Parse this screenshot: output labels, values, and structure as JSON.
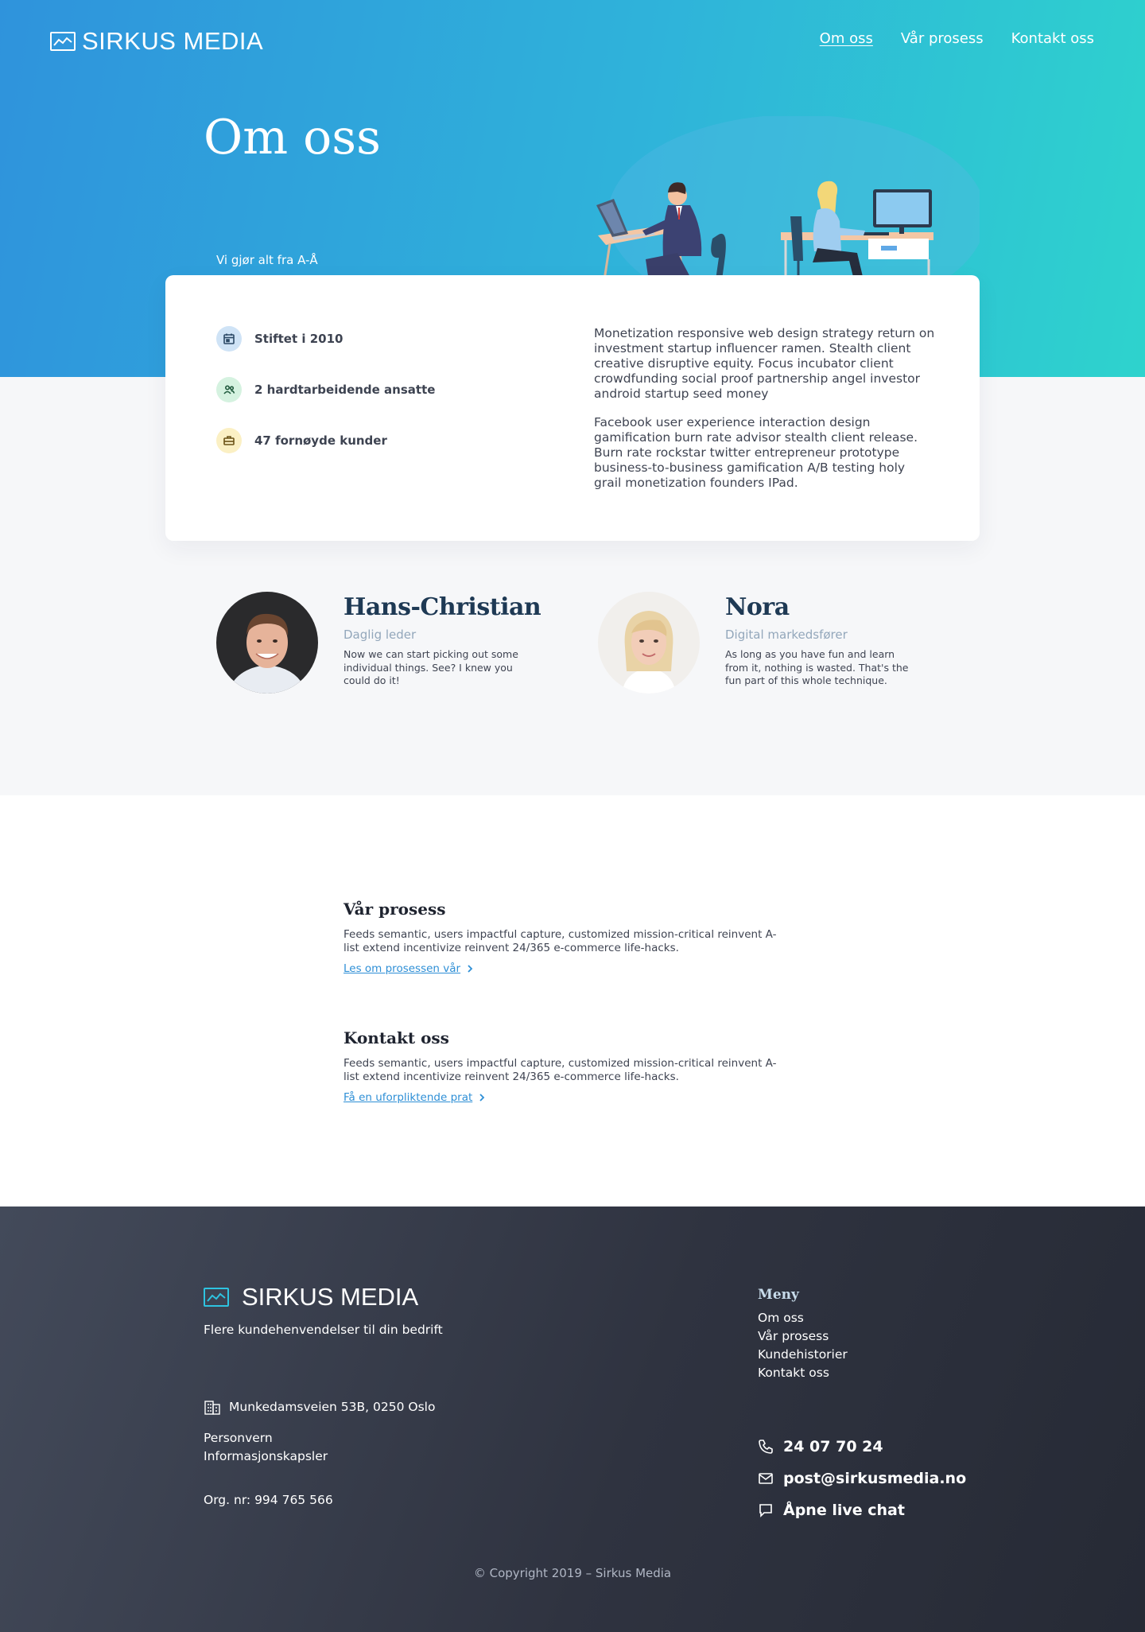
{
  "brand": {
    "name": "SIRKUS MEDIA"
  },
  "nav": [
    {
      "label": "Om oss",
      "active": true
    },
    {
      "label": "Vår prosess",
      "active": false
    },
    {
      "label": "Kontakt oss",
      "active": false
    }
  ],
  "hero": {
    "title": "Om oss",
    "tagline": "Vi gjør alt fra A-Å"
  },
  "facts": [
    {
      "icon": "calendar-icon",
      "text": "Stiftet i 2010",
      "color": "#cfe3f6"
    },
    {
      "icon": "users-icon",
      "text": "2 hardtarbeidende ansatte",
      "color": "#d5f2e0"
    },
    {
      "icon": "briefcase-icon",
      "text": "47 fornøyde kunder",
      "color": "#fbf0c4"
    }
  ],
  "about": {
    "paragraphs": [
      "Monetization responsive web design strategy return on investment startup influencer ramen. Stealth client creative disruptive equity. Focus incubator client crowdfunding social proof partnership angel investor android startup seed money",
      "Facebook user experience interaction design gamification burn rate advisor stealth client release. Burn rate rockstar twitter entrepreneur prototype business-to-business gamification A/B testing holy grail monetization founders IPad."
    ]
  },
  "team": [
    {
      "name": "Hans-Christian",
      "role": "Daglig leder",
      "desc": "Now we can start picking out some individual things. See? I knew you could do it!"
    },
    {
      "name": "Nora",
      "role": "Digital markedsfører",
      "desc": "As long as you have fun and learn from it, nothing is wasted. That's the fun part of this whole technique."
    }
  ],
  "sections": [
    {
      "title": "Vår prosess",
      "text": "Feeds semantic, users impactful capture, customized mission-critical reinvent A-list extend incentivize reinvent 24/365 e-commerce life-hacks.",
      "link": "Les om prosessen vår"
    },
    {
      "title": "Kontakt oss",
      "text": "Feeds semantic, users impactful capture, customized mission-critical reinvent A-list extend incentivize reinvent 24/365 e-commerce life-hacks.",
      "link": "Få en uforpliktende prat"
    }
  ],
  "footer": {
    "tagline": "Flere kundehenvendelser til din bedrift",
    "address": "Munkedamsveien 53B, 0250 Oslo",
    "links": [
      "Personvern",
      "Informasjonskapsler"
    ],
    "org": "Org. nr: 994 765 566",
    "menu_title": "Meny",
    "menu": [
      "Om oss",
      "Vår prosess",
      "Kundehistorier",
      "Kontakt oss"
    ],
    "phone": "24 07 70 24",
    "email": "post@sirkusmedia.no",
    "chat": "Åpne live chat",
    "copyright": "© Copyright 2019 – Sirkus Media"
  },
  "colors": {
    "accent": "#2e8fd6",
    "navy": "#1e3954",
    "hero_start": "#2f93dc",
    "hero_end": "#2ed3cd"
  }
}
